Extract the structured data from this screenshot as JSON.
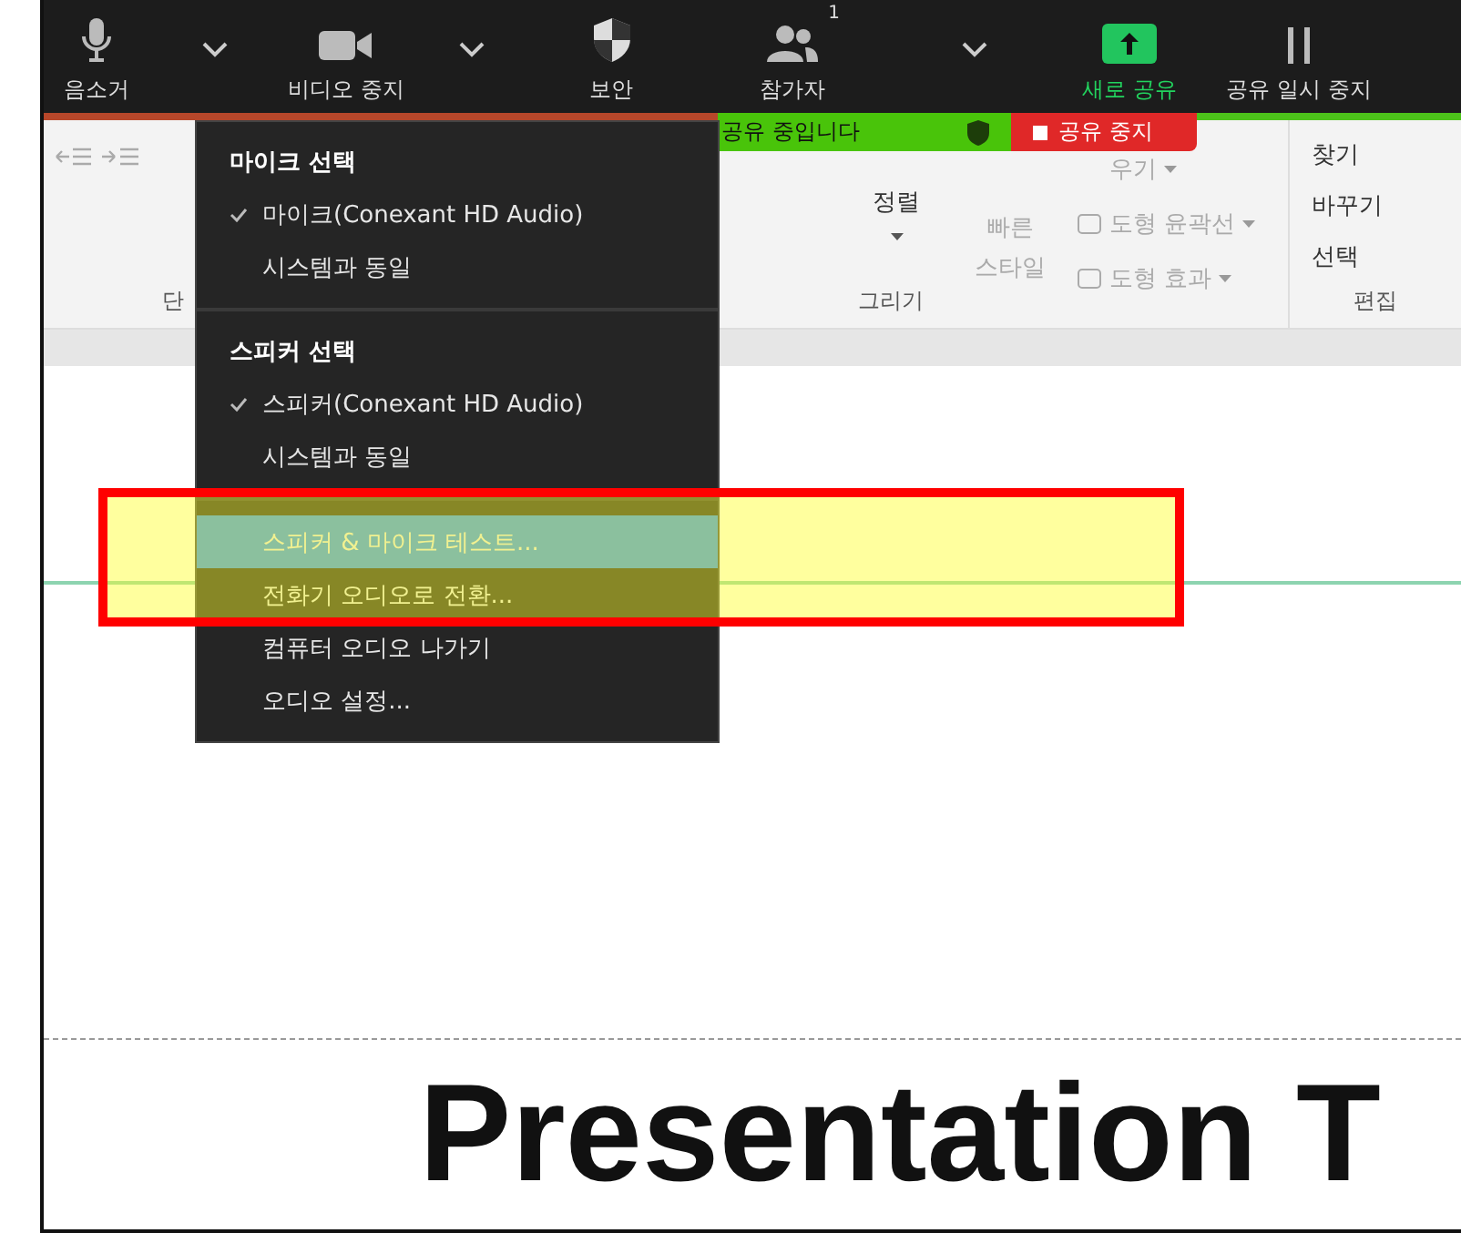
{
  "toolbar": {
    "items": [
      {
        "kind": "button",
        "label": "음소거",
        "highlight": false
      },
      {
        "kind": "caret"
      },
      {
        "kind": "button",
        "label": "비디오 중지",
        "highlight": false
      },
      {
        "kind": "caret"
      },
      {
        "kind": "button",
        "label": "보안",
        "highlight": false
      },
      {
        "kind": "button",
        "label": "참가자",
        "badge": "1",
        "highlight": false
      },
      {
        "kind": "caret"
      },
      {
        "kind": "button",
        "label": "새로 공유",
        "highlight": true
      },
      {
        "kind": "button",
        "label": "공유 일시 중지",
        "highlight": false
      }
    ]
  },
  "share_banner": {
    "status": "공유 중입니다",
    "stop": "공유 중지"
  },
  "ribbon": {
    "groups": [
      {
        "label": "단"
      },
      {
        "label": "그리기",
        "arrange": "정렬",
        "quick_styles": [
          "빠른",
          "스타일"
        ],
        "commands": [
          "우기",
          "도형 윤곽선",
          "도형 효과"
        ]
      },
      {
        "label": "편집",
        "commands": [
          "찾기",
          "바꾸기",
          "선택"
        ]
      }
    ]
  },
  "audio_menu": {
    "items": [
      {
        "kind": "header",
        "label": "마이크 선택"
      },
      {
        "kind": "item",
        "label": "마이크(Conexant HD Audio)",
        "checked": true,
        "selected": false
      },
      {
        "kind": "item",
        "label": "시스템과 동일",
        "checked": false,
        "selected": false
      },
      {
        "kind": "separator"
      },
      {
        "kind": "header",
        "label": "스피커 선택"
      },
      {
        "kind": "item",
        "label": "스피커(Conexant HD Audio)",
        "checked": true,
        "selected": false
      },
      {
        "kind": "item",
        "label": "시스템과 동일",
        "checked": false,
        "selected": false
      },
      {
        "kind": "separator"
      },
      {
        "kind": "item",
        "label": "스피커 & 마이크 테스트...",
        "checked": false,
        "selected": true
      },
      {
        "kind": "item",
        "label": "전화기 오디오로 전환...",
        "checked": false,
        "selected": false
      },
      {
        "kind": "item",
        "label": "컴퓨터 오디오 나가기",
        "checked": false,
        "selected": false
      },
      {
        "kind": "item",
        "label": "오디오 설정...",
        "checked": false,
        "selected": false
      }
    ]
  },
  "slide": {
    "title": "Presentation T"
  }
}
